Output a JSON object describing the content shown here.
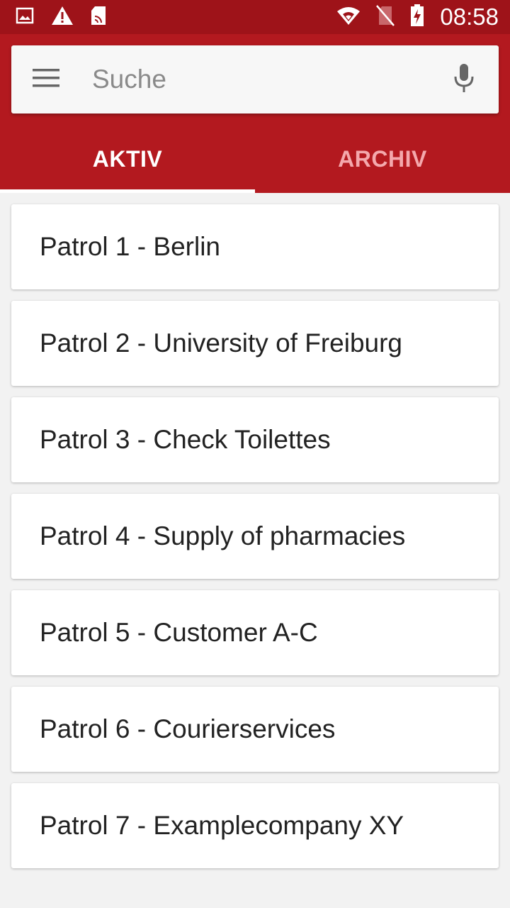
{
  "status_bar": {
    "time": "08:58",
    "left_icons": [
      "image-icon",
      "warning-icon",
      "sd-card-icon"
    ],
    "right_icons": [
      "wifi-icon",
      "no-sim-icon",
      "battery-charging-icon"
    ]
  },
  "search": {
    "placeholder": "Suche",
    "value": ""
  },
  "tabs": [
    {
      "label": "AKTIV",
      "active": true
    },
    {
      "label": "ARCHIV",
      "active": false
    }
  ],
  "patrols": [
    {
      "label": "Patrol 1 - Berlin"
    },
    {
      "label": "Patrol 2 - University of Freiburg"
    },
    {
      "label": "Patrol 3 - Check Toilettes"
    },
    {
      "label": "Patrol 4 - Supply of pharmacies"
    },
    {
      "label": "Patrol 5 - Customer A-C"
    },
    {
      "label": "Patrol 6 - Courierservices"
    },
    {
      "label": "Patrol 7 - Examplecompany XY"
    }
  ],
  "colors": {
    "status_bar": "#9e1319",
    "app_bar": "#b3191f",
    "inactive_tab": "#f4a8ac",
    "background": "#f2f2f2"
  }
}
